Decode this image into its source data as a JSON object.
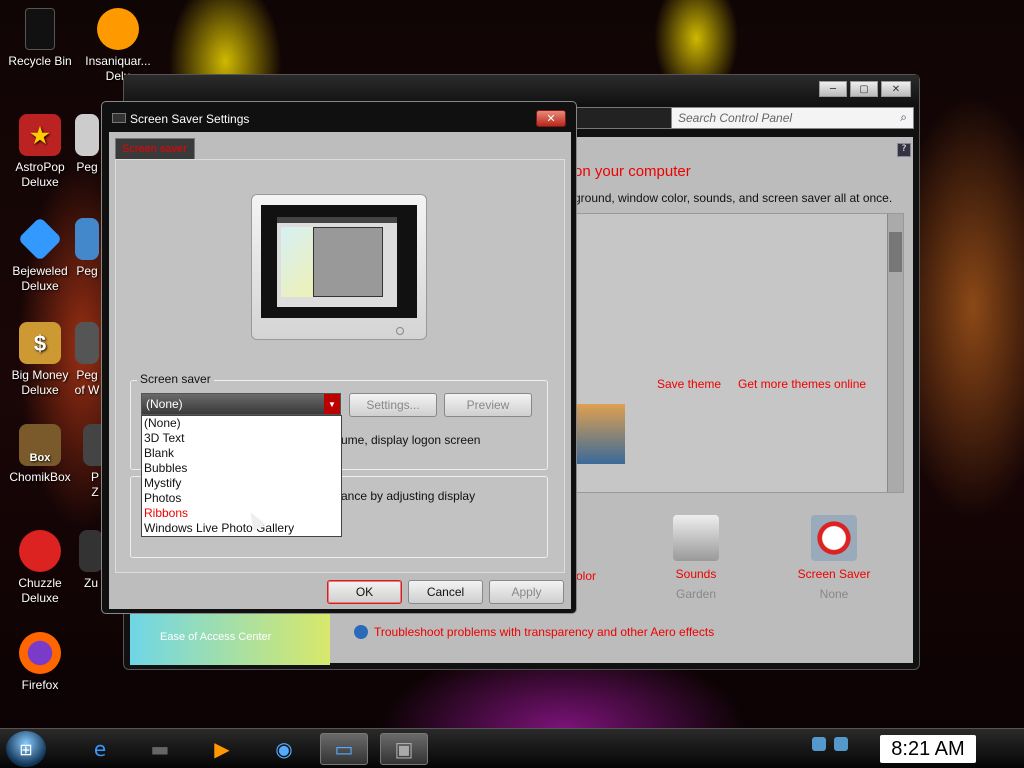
{
  "desktop": {
    "icons": [
      {
        "label": "Recycle Bin"
      },
      {
        "label": "Insaniquar...\nDelu"
      },
      {
        "label": "AstroPop\nDeluxe"
      },
      {
        "label": "Peg"
      },
      {
        "label": "Bejeweled\nDeluxe"
      },
      {
        "label": "Peg"
      },
      {
        "label": "Big Money\nDeluxe"
      },
      {
        "label": "Peg\nof W"
      },
      {
        "label": "ChomikBox"
      },
      {
        "label": "P\nZ"
      },
      {
        "label": "Chuzzle\nDeluxe"
      },
      {
        "label": "Zu"
      },
      {
        "label": "Firefox"
      }
    ],
    "chomik_badge": "Box"
  },
  "control_panel": {
    "search_placeholder": "Search Control Panel",
    "heading": "on your computer",
    "subheading": "ground, window color, sounds, and screen saver all at once.",
    "save_theme": "Save theme",
    "get_more_themes": "Get more themes online",
    "partial_text": "olor",
    "sounds_label": "Sounds",
    "sounds_value": "Garden",
    "screensaver_label": "Screen Saver",
    "screensaver_value": "None",
    "ease_of_access": "Ease of Access Center",
    "troubleshoot": "Troubleshoot problems with transparency and other Aero effects"
  },
  "dialog": {
    "title": "Screen Saver Settings",
    "tab": "Screen saver",
    "group1_legend": "Screen saver",
    "dropdown_value": "(None)",
    "settings_btn": "Settings...",
    "preview_btn": "Preview",
    "resume_text": "ume, display logon screen",
    "power_text": "ance by adjusting display",
    "ok": "OK",
    "cancel": "Cancel",
    "apply": "Apply",
    "options": [
      "(None)",
      "3D Text",
      "Blank",
      "Bubbles",
      "Mystify",
      "Photos",
      "Ribbons",
      "Windows Live Photo Gallery"
    ],
    "selected_option": "Ribbons"
  },
  "taskbar": {
    "clock": "8:21 AM"
  },
  "colors": {
    "accent_red": "#e00000",
    "dialog_bg": "#bdbdbd"
  }
}
